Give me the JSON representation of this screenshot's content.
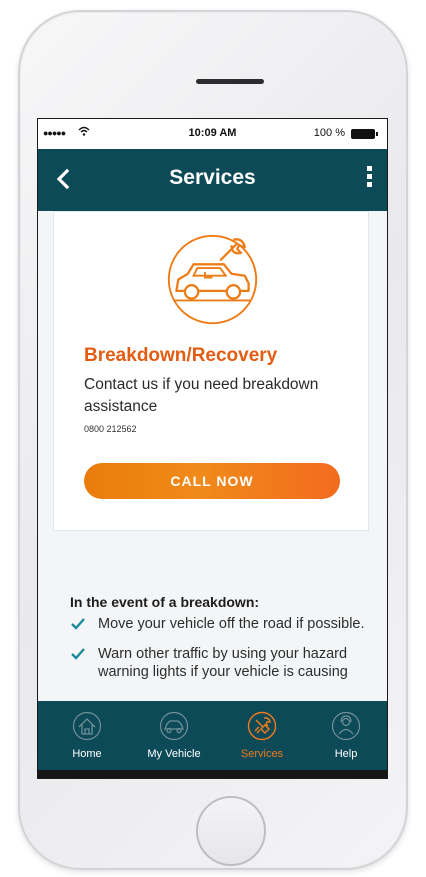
{
  "status_bar": {
    "signal": "●●●●●",
    "time": "10:09 AM",
    "battery": "100 %"
  },
  "header": {
    "title": "Services"
  },
  "service_card": {
    "title": "Breakdown/Recovery",
    "description": "Contact us if you need breakdown assistance",
    "phone": "0800 212562",
    "button_label": "CALL NOW"
  },
  "breakdown_info": {
    "heading": "In the event of a breakdown:",
    "items": [
      "Move your vehicle off the road if possible.",
      "Warn other traffic by using your hazard warning lights if your vehicle is causing"
    ]
  },
  "tabs": [
    {
      "label": "Home",
      "icon": "home-icon",
      "active": false
    },
    {
      "label": "My Vehicle",
      "icon": "car-icon",
      "active": false
    },
    {
      "label": "Services",
      "icon": "services-icon",
      "active": true
    },
    {
      "label": "Help",
      "icon": "help-icon",
      "active": false
    }
  ],
  "colors": {
    "brand_teal": "#0d4a58",
    "accent_orange": "#ee7c16",
    "check_teal": "#1a8a9a"
  }
}
